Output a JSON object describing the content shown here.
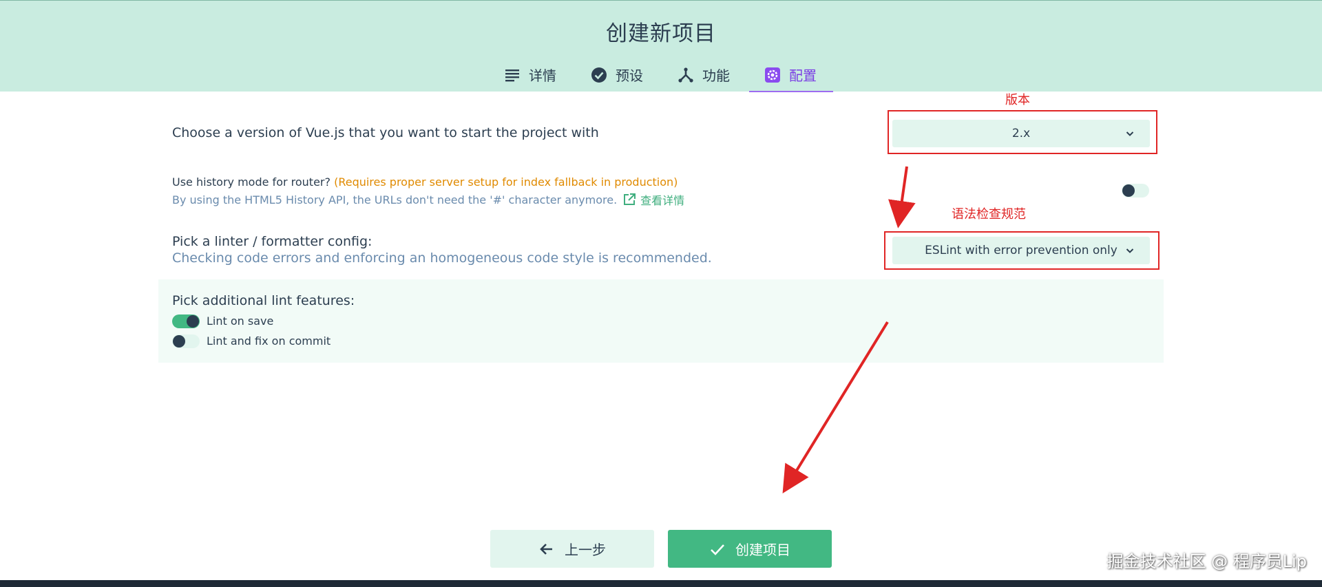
{
  "header": {
    "title": "创建新项目",
    "tabs": [
      {
        "label": "详情",
        "icon": "list-icon"
      },
      {
        "label": "预设",
        "icon": "check-circle-icon"
      },
      {
        "label": "功能",
        "icon": "fork-icon"
      },
      {
        "label": "配置",
        "icon": "gear-icon",
        "active": true
      }
    ]
  },
  "config": {
    "vue_version": {
      "label": "Choose a version of Vue.js that you want to start the project with",
      "value": "2.x"
    },
    "history_mode": {
      "label": "Use history mode for router?",
      "warning": "(Requires proper server setup for index fallback in production)",
      "description": "By using the HTML5 History API, the URLs don't need the '#' character anymore.",
      "link_text": "查看详情",
      "enabled": false
    },
    "linter": {
      "label": "Pick a linter / formatter config:",
      "description": "Checking code errors and enforcing an homogeneous code style is recommended.",
      "value": "ESLint with error prevention only"
    },
    "lint_features": {
      "label": "Pick additional lint features:",
      "options": [
        {
          "label": "Lint on save",
          "enabled": true
        },
        {
          "label": "Lint and fix on commit",
          "enabled": false
        }
      ]
    }
  },
  "annotations": {
    "version": "版本",
    "lint_rules": "语法检查规范"
  },
  "footer": {
    "prev_label": "上一步",
    "create_label": "创建项目"
  },
  "watermark": "掘金技术社区 @ 程序员Lip",
  "colors": {
    "header_bg": "#c9ece0",
    "accent": "#42b883",
    "active_tab": "#7b3fe4",
    "annotation": "#e02525",
    "warning": "#e08a00"
  }
}
